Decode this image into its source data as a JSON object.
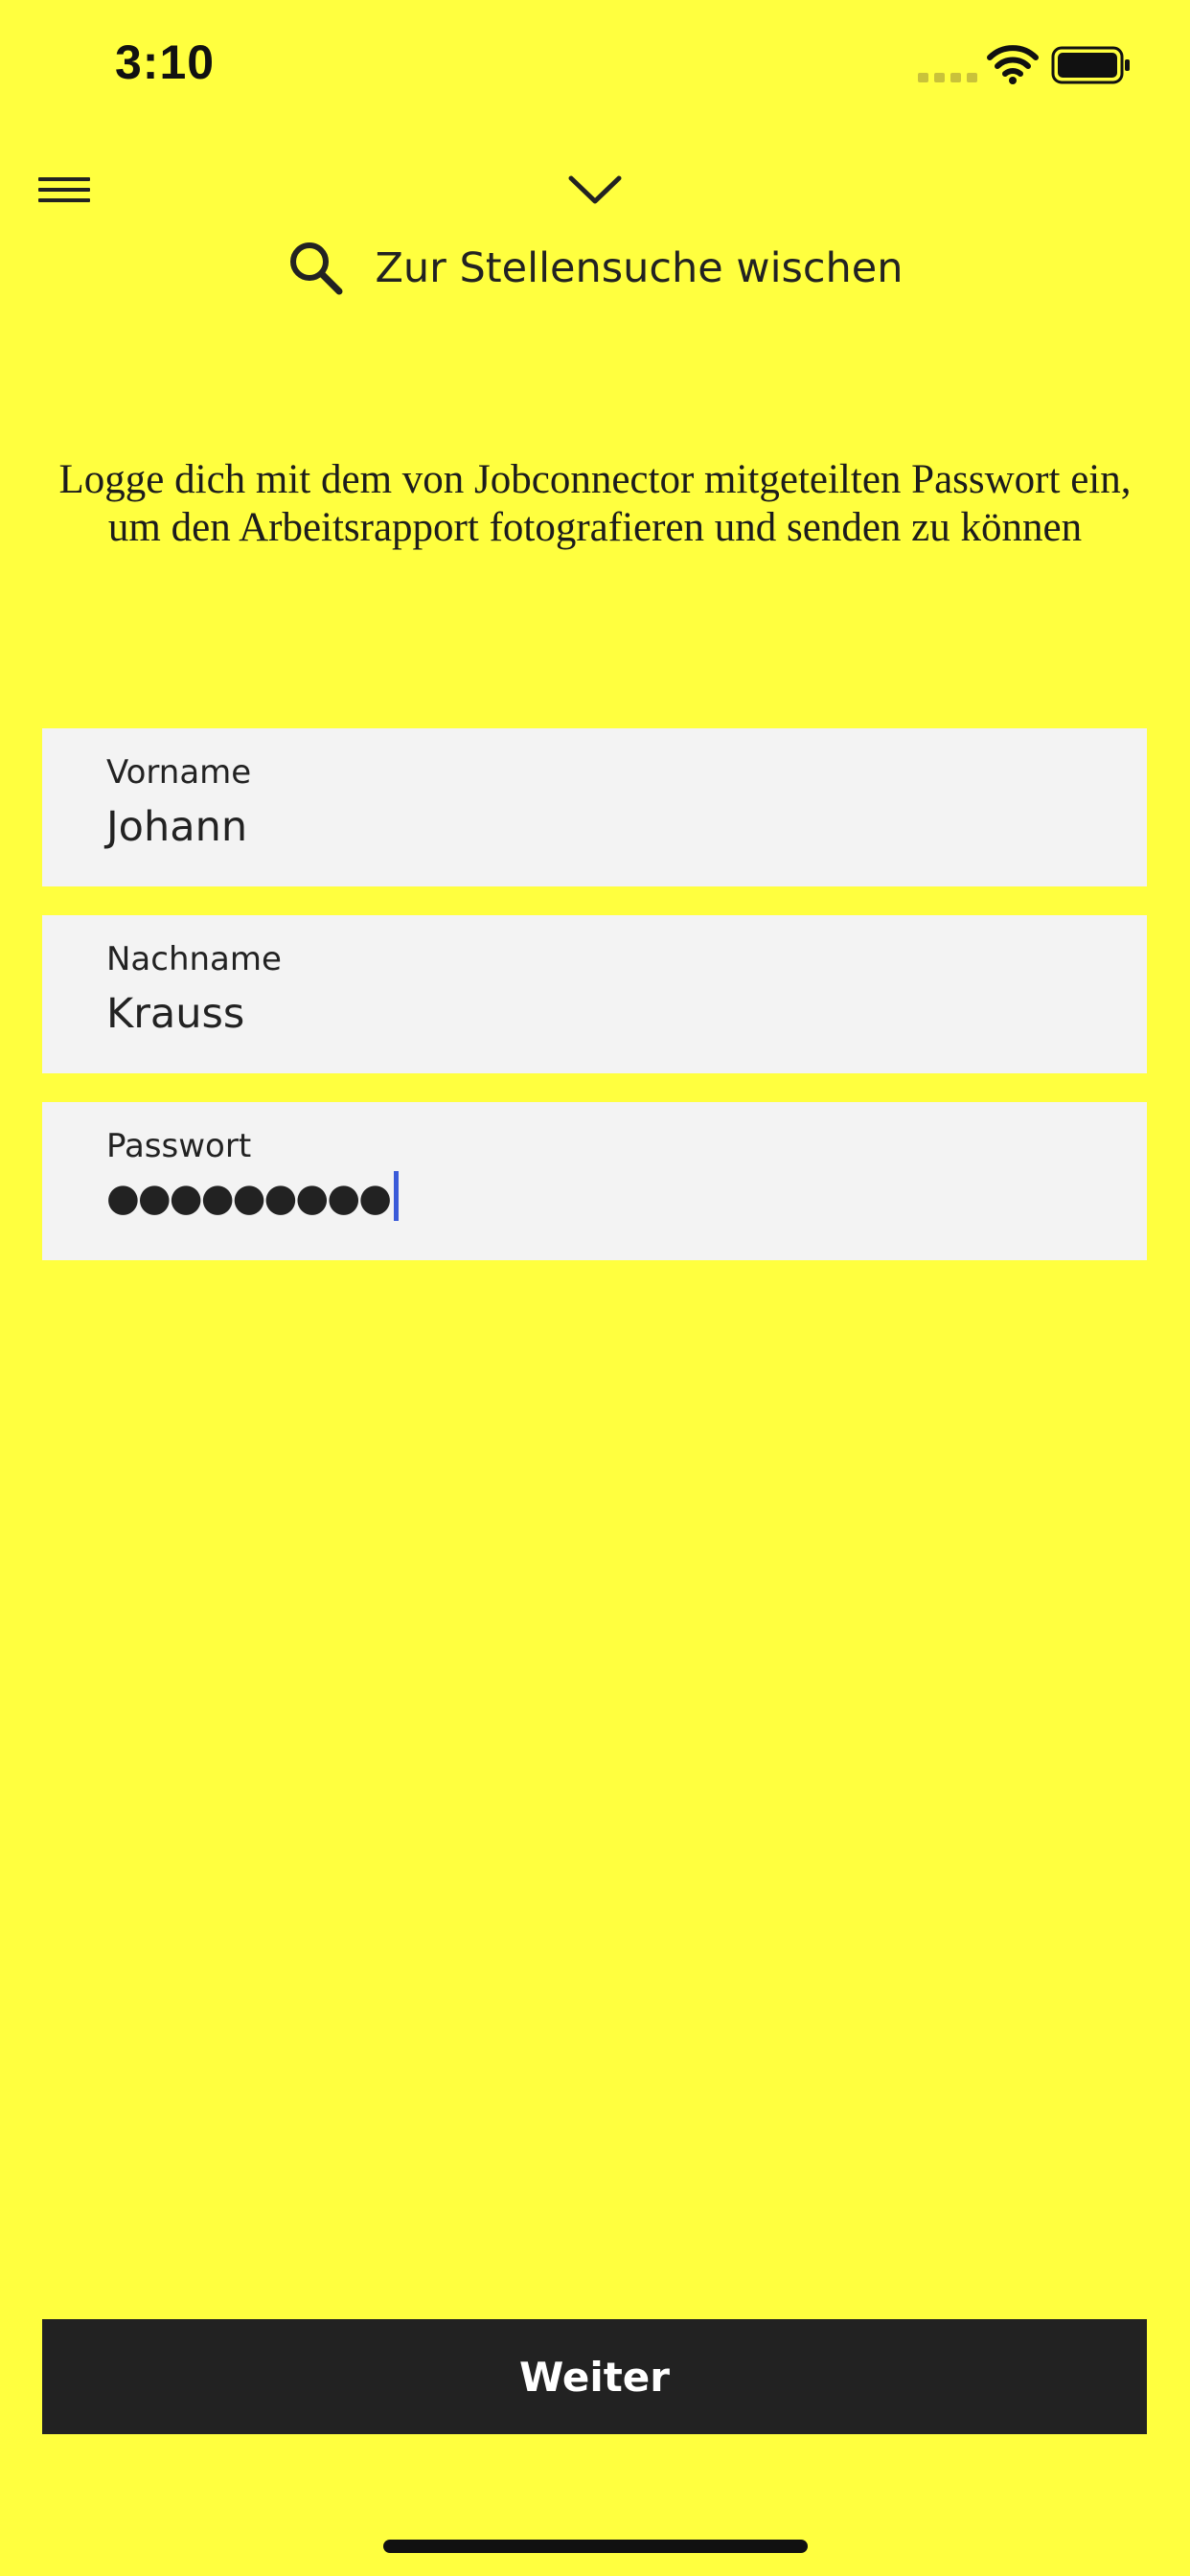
{
  "status_bar": {
    "time": "3:10"
  },
  "header": {
    "menu_icon": "hamburger-menu-icon",
    "collapse_icon": "chevron-down-icon",
    "search_icon": "search-icon",
    "search_swipe_label": "Zur Stellensuche wischen"
  },
  "instruction": {
    "text": "Logge dich mit dem von Jobconnector mitgeteilten Passwort ein, um den Arbeitsrapport fotografieren und senden zu können"
  },
  "form": {
    "first_name": {
      "label": "Vorname",
      "value": "Johann"
    },
    "last_name": {
      "label": "Nachname",
      "value": "Krauss"
    },
    "password": {
      "label": "Passwort",
      "value": "●●●●●●●●●"
    }
  },
  "actions": {
    "continue_label": "Weiter"
  },
  "colors": {
    "background": "#ffff3f",
    "field_background": "#f3f3f3",
    "button_background": "#222222",
    "button_text": "#ffffff",
    "caret": "#3a5bd9"
  }
}
